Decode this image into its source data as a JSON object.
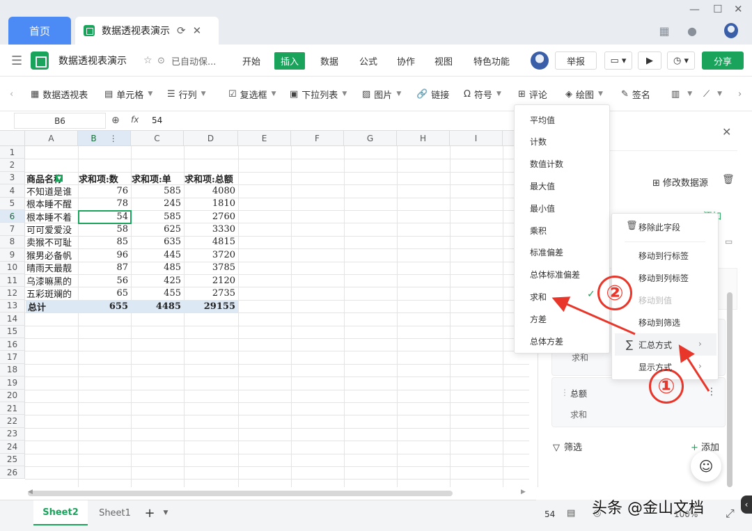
{
  "tabs": {
    "home": "首页",
    "doc": "数据透视表演示"
  },
  "menu": {
    "doc_title": "数据透视表演示",
    "autosave": "已自动保...",
    "items": [
      "开始",
      "插入",
      "数据",
      "公式",
      "协作",
      "视图",
      "特色功能"
    ],
    "report": "举报",
    "share": "分享"
  },
  "toolbar": {
    "items": [
      "数据透视表",
      "单元格",
      "行列",
      "复选框",
      "下拉列表",
      "图片",
      "链接",
      "符号",
      "评论",
      "绘图",
      "签名"
    ]
  },
  "formula": {
    "cell_ref": "B6",
    "fx": "fx",
    "value": "54"
  },
  "grid": {
    "columns": [
      "A",
      "B",
      "C",
      "D",
      "E",
      "F",
      "G",
      "H",
      "I"
    ],
    "rows": [
      "1",
      "2",
      "3",
      "4",
      "5",
      "6",
      "7",
      "8",
      "9",
      "10",
      "11",
      "12",
      "13",
      "14",
      "15",
      "16",
      "17",
      "18",
      "19",
      "20",
      "21",
      "22",
      "23",
      "24",
      "25",
      "26"
    ],
    "header_row": [
      "商品名称",
      "求和项:数",
      "求和项:单",
      "求和项:总额"
    ],
    "data_rows": [
      [
        "不知道是谁",
        "76",
        "585",
        "4080"
      ],
      [
        "根本睡不醒",
        "78",
        "245",
        "1810"
      ],
      [
        "根本睡不着",
        "54",
        "585",
        "2760"
      ],
      [
        "可可爱爱没",
        "58",
        "625",
        "3330"
      ],
      [
        "卖猴不可耻",
        "85",
        "635",
        "4815"
      ],
      [
        "猴男必备帆",
        "96",
        "445",
        "3720"
      ],
      [
        "晴雨天最靓",
        "87",
        "485",
        "3785"
      ],
      [
        "乌漆嘛黑的",
        "56",
        "425",
        "2120"
      ],
      [
        "五彩斑斓的",
        "65",
        "455",
        "2735"
      ]
    ],
    "total_row": [
      "总计",
      "655",
      "4485",
      "29155"
    ]
  },
  "sheets": {
    "tab1": "Sheet2",
    "tab2": "Sheet1",
    "add": "+"
  },
  "panel": {
    "modify_source": "修改数据源",
    "add": "添加",
    "card1_sub": "求和",
    "card2_title": "总额",
    "card2_sub": "求和",
    "filter": "筛选",
    "filter_add": "添加"
  },
  "summary_menu": [
    "平均值",
    "计数",
    "数值计数",
    "最大值",
    "最小值",
    "乘积",
    "标准偏差",
    "总体标准偏差",
    "求和",
    "方差",
    "总体方差"
  ],
  "context_menu": [
    "移除此字段",
    "移动到行标签",
    "移动到列标签",
    "移动到值",
    "移动到筛选",
    "汇总方式",
    "显示方式"
  ],
  "annotations": {
    "one": "①",
    "two": "②"
  },
  "status": {
    "value": "54",
    "zoom": "100%"
  },
  "watermark": "头条 @金山文档",
  "colors": {
    "brand": "#1aa35b",
    "accent": "#4c8bf5",
    "annotation": "#e8362b"
  }
}
